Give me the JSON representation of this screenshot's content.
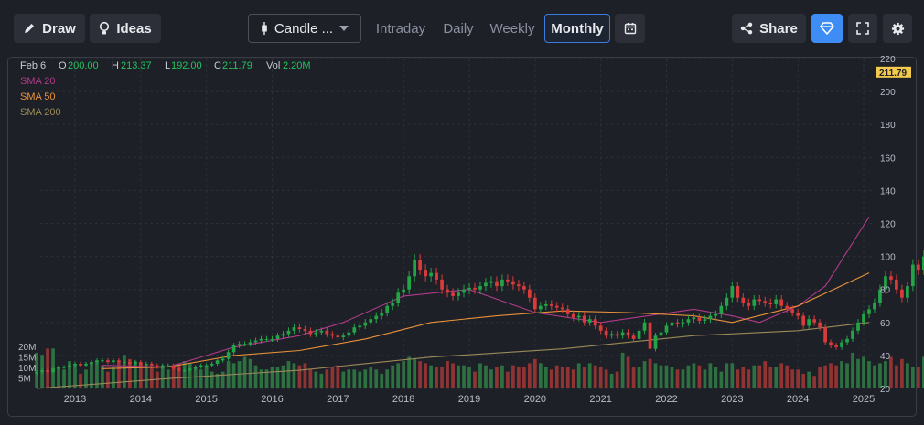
{
  "toolbar": {
    "draw_label": "Draw",
    "ideas_label": "Ideas",
    "chart_type_label": "Candle ...",
    "intervals": [
      "Intraday",
      "Daily",
      "Weekly",
      "Monthly"
    ],
    "active_interval": "Monthly",
    "share_label": "Share",
    "accent_color": "#3d8df5"
  },
  "legend": {
    "date": "Feb 6",
    "open_label": "O",
    "open": "200.00",
    "high_label": "H",
    "high": "213.37",
    "low_label": "L",
    "low": "192.00",
    "close_label": "C",
    "close": "211.79",
    "vol_label": "Vol",
    "vol": "2.20M",
    "value_color": "#22c55e",
    "sma": [
      {
        "label": "SMA 20",
        "color": "#b03a8a"
      },
      {
        "label": "SMA 50",
        "color": "#e8913a"
      },
      {
        "label": "SMA 200",
        "color": "#9a8a58"
      }
    ]
  },
  "price_axis": {
    "ticks": [
      "220",
      "200",
      "180",
      "160",
      "140",
      "120",
      "100",
      "80",
      "60",
      "40",
      "20"
    ],
    "last_price": "211.79",
    "last_price_color": "#f2c94c"
  },
  "volume_axis": {
    "ticks": [
      "20M",
      "15M",
      "10M",
      "5M"
    ]
  },
  "time_axis": {
    "labels": [
      "2013",
      "2014",
      "2015",
      "2016",
      "2017",
      "2018",
      "2019",
      "2020",
      "2021",
      "2022",
      "2023",
      "2024",
      "2025"
    ]
  },
  "chart_data": {
    "type": "candlestick",
    "interval": "monthly",
    "ylim": [
      20,
      220
    ],
    "up_color": "#22a447",
    "down_color": "#d93b3b",
    "grid": true,
    "legend_position": "top-left",
    "x_start": "2012-06",
    "closes": [
      30,
      31,
      30,
      32,
      33,
      33,
      34,
      35,
      34,
      35,
      36,
      37,
      37,
      36,
      37,
      36,
      36,
      35,
      36,
      34,
      35,
      34,
      33,
      34,
      34,
      32,
      31,
      31,
      32,
      33,
      34,
      34,
      35,
      37,
      38,
      42,
      46,
      47,
      47,
      48,
      49,
      50,
      50,
      50,
      52,
      53,
      55,
      57,
      56,
      55,
      53,
      54,
      55,
      53,
      52,
      51,
      52,
      54,
      57,
      58,
      60,
      62,
      64,
      66,
      70,
      72,
      78,
      80,
      88,
      98,
      92,
      88,
      90,
      86,
      80,
      78,
      76,
      78,
      80,
      81,
      80,
      82,
      84,
      85,
      82,
      86,
      85,
      83,
      82,
      80,
      75,
      68,
      70,
      71,
      70,
      69,
      68,
      65,
      63,
      64,
      60,
      62,
      58,
      55,
      52,
      53,
      52,
      54,
      52,
      50,
      55,
      60,
      44,
      52,
      54,
      58,
      60,
      59,
      60,
      62,
      63,
      61,
      62,
      64,
      65,
      70,
      75,
      82,
      75,
      72,
      70,
      74,
      73,
      72,
      71,
      74,
      70,
      68,
      66,
      64,
      58,
      62,
      60,
      57,
      48,
      46,
      45,
      48,
      50,
      55,
      60,
      65,
      68,
      72,
      80,
      88,
      86,
      80,
      75,
      82,
      95,
      92,
      100,
      95,
      96,
      105,
      108,
      105,
      110,
      130,
      120,
      143,
      150,
      190,
      180,
      212
    ],
    "volumes_m": [
      17,
      16,
      19,
      19,
      10,
      9,
      13,
      11,
      7,
      9,
      12,
      13,
      11,
      8,
      10,
      13,
      16,
      14,
      13,
      11,
      10,
      10,
      8,
      10,
      9,
      10,
      12,
      13,
      12,
      10,
      9,
      11,
      8,
      7,
      8,
      13,
      12,
      13,
      15,
      14,
      11,
      9,
      9,
      10,
      10,
      11,
      13,
      12,
      11,
      12,
      9,
      8,
      7,
      9,
      10,
      11,
      8,
      9,
      9,
      8,
      9,
      10,
      9,
      7,
      9,
      11,
      12,
      13,
      15,
      14,
      13,
      12,
      11,
      10,
      10,
      13,
      12,
      11,
      11,
      10,
      8,
      12,
      11,
      9,
      10,
      11,
      8,
      11,
      10,
      10,
      12,
      14,
      12,
      10,
      9,
      11,
      10,
      10,
      9,
      12,
      10,
      12,
      11,
      10,
      9,
      7,
      8,
      17,
      15,
      10,
      10,
      13,
      14,
      12,
      11,
      11,
      10,
      9,
      9,
      11,
      12,
      11,
      9,
      12,
      10,
      8,
      12,
      12,
      9,
      10,
      9,
      11,
      11,
      13,
      10,
      10,
      12,
      11,
      9,
      9,
      7,
      8,
      6,
      10,
      11,
      12,
      11,
      13,
      12,
      17,
      14,
      15,
      13,
      11,
      12,
      13,
      15,
      11,
      14,
      12,
      10,
      10,
      15,
      12,
      19,
      17,
      13,
      11,
      16,
      17,
      14,
      13,
      15,
      12,
      13,
      14,
      12,
      12,
      10
    ],
    "sma20": {
      "x": [
        "2013-06",
        "2014-06",
        "2015-06",
        "2016-06",
        "2017-02",
        "2018-01",
        "2019-01",
        "2020-01",
        "2021-01",
        "2022-06",
        "2023-01",
        "2023-06",
        "2024-01",
        "2024-06",
        "2025-02"
      ],
      "y": [
        34,
        33,
        45,
        52,
        60,
        76,
        80,
        66,
        60,
        68,
        64,
        60,
        70,
        82,
        124
      ]
    },
    "sma50": {
      "x": [
        "2013-06",
        "2014-06",
        "2015-06",
        "2016-06",
        "2017-06",
        "2018-06",
        "2019-06",
        "2020-06",
        "2021-06",
        "2022-06",
        "2023-01",
        "2024-01",
        "2025-02"
      ],
      "y": [
        32,
        33,
        40,
        43,
        50,
        60,
        64,
        67,
        66,
        64,
        60,
        70,
        90
      ]
    },
    "sma200": {
      "x": [
        "2012-06",
        "2014-06",
        "2016-06",
        "2018-06",
        "2020-06",
        "2022-06",
        "2024-01",
        "2025-02"
      ],
      "y": [
        20,
        26,
        31,
        39,
        44,
        52,
        55,
        60
      ]
    }
  }
}
